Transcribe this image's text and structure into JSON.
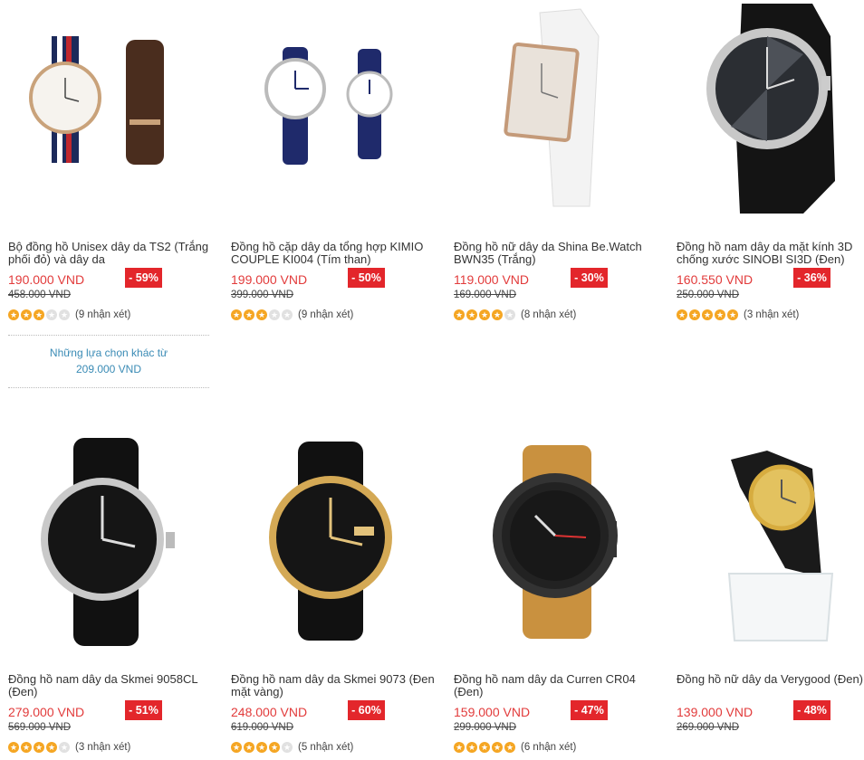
{
  "products": [
    {
      "title": "Bộ đồng hồ Unisex dây da TS2 (Trắng phối đỏ) và dây da",
      "price": "190.000 VND",
      "old_price": "458.000 VND",
      "discount": "- 59%",
      "rating": 3,
      "reviews": "(9 nhận xét)",
      "icon": "watch-set-icon"
    },
    {
      "title": "Đồng hồ cặp dây da tổng hợp KIMIO COUPLE KI004 (Tím than)",
      "price": "199.000 VND",
      "old_price": "399.000 VND",
      "discount": "- 50%",
      "rating": 3,
      "reviews": "(9 nhận xét)",
      "icon": "couple-watch-icon"
    },
    {
      "title": "Đồng hồ nữ dây da Shina Be.Watch BWN35 (Trắng)",
      "price": "119.000 VND",
      "old_price": "169.000 VND",
      "discount": "- 30%",
      "rating": 4,
      "reviews": "(8 nhận xét)",
      "icon": "white-watch-icon"
    },
    {
      "title": "Đồng hồ nam dây da mặt kính 3D chống xước SINOBI SI3D (Đen)",
      "price": "160.550 VND",
      "old_price": "250.000 VND",
      "discount": "- 36%",
      "rating": 5,
      "reviews": "(3 nhận xét)",
      "icon": "black-watch-icon"
    },
    {
      "title": "Đồng hồ nam dây da Skmei 9058CL (Đen)",
      "price": "279.000 VND",
      "old_price": "569.000 VND",
      "discount": "- 51%",
      "rating": 3.5,
      "reviews": "(3 nhận xét)",
      "icon": "skmei-watch-icon"
    },
    {
      "title": "Đồng hồ nam dây da Skmei 9073 (Đen mặt vàng)",
      "price": "248.000 VND",
      "old_price": "619.000 VND",
      "discount": "- 60%",
      "rating": 3.5,
      "reviews": "(5 nhận xét)",
      "icon": "gold-watch-icon"
    },
    {
      "title": "Đồng hồ nam dây da Curren CR04 (Đen)",
      "price": "159.000 VND",
      "old_price": "299.000 VND",
      "discount": "- 47%",
      "rating": 5,
      "reviews": "(6 nhận xét)",
      "icon": "curren-watch-icon"
    },
    {
      "title": "Đồng hồ nữ dây da Verygood (Đen)",
      "price": "139.000 VND",
      "old_price": "269.000 VND",
      "discount": "- 48%",
      "rating": 0,
      "reviews": "",
      "icon": "verygood-watch-icon"
    }
  ],
  "alternatives": {
    "line1": "Những lựa chọn khác từ",
    "line2": "209.000 VND"
  }
}
